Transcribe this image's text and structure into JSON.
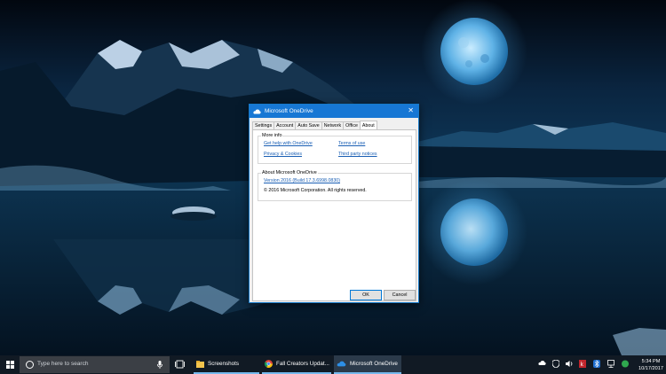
{
  "dialog": {
    "title": "Microsoft OneDrive",
    "close_glyph": "✕",
    "tabs": [
      "Settings",
      "Account",
      "Auto Save",
      "Network",
      "Office",
      "About"
    ],
    "active_tab": "About",
    "more_info": {
      "heading": "More info",
      "links": [
        "Get help with OneDrive",
        "Terms of use",
        "Privacy & Cookies",
        "Third party notices"
      ]
    },
    "about": {
      "heading": "About Microsoft OneDrive",
      "version_link": "Version 2016 (Build 17.3.6998.0830)",
      "copyright": "© 2016 Microsoft Corporation. All rights reserved."
    },
    "ok_label": "OK",
    "cancel_label": "Cancel"
  },
  "taskbar": {
    "search_placeholder": "Type here to search",
    "apps": [
      {
        "label": "Screenshots",
        "icon": "folder-icon"
      },
      {
        "label": "Fall Creators Updat...",
        "icon": "chrome-icon"
      },
      {
        "label": "Microsoft OneDrive",
        "icon": "onedrive-cloud-icon"
      }
    ],
    "clock_time": "5:34 PM",
    "clock_date": "10/17/2017"
  },
  "colors": {
    "accent": "#1777d4",
    "taskbar": "#111a24",
    "link": "#1a5fb4"
  }
}
